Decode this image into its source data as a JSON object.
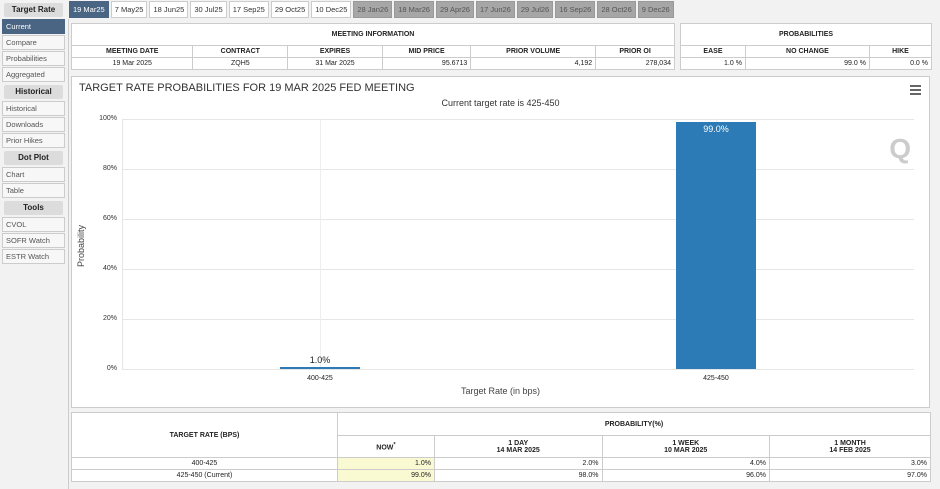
{
  "sidebar": {
    "sections": [
      {
        "title": "Target Rate",
        "items": [
          "Current",
          "Compare",
          "Probabilities",
          "Aggregated"
        ]
      },
      {
        "title": "Historical",
        "items": [
          "Historical",
          "Downloads",
          "Prior Hikes"
        ]
      },
      {
        "title": "Dot Plot",
        "items": [
          "Chart",
          "Table"
        ]
      },
      {
        "title": "Tools",
        "items": [
          "CVOL",
          "SOFR Watch",
          "ESTR Watch"
        ]
      }
    ]
  },
  "tabs": [
    "19 Mar25",
    "7 May25",
    "18 Jun25",
    "30 Jul25",
    "17 Sep25",
    "29 Oct25",
    "10 Dec25",
    "28 Jan26",
    "18 Mar26",
    "29 Apr26",
    "17 Jun26",
    "29 Jul26",
    "16 Sep26",
    "28 Oct26",
    "9 Dec26"
  ],
  "meeting": {
    "title": "MEETING INFORMATION",
    "headers": [
      "MEETING DATE",
      "CONTRACT",
      "EXPIRES",
      "MID PRICE",
      "PRIOR VOLUME",
      "PRIOR OI"
    ],
    "values": [
      "19 Mar 2025",
      "ZQH5",
      "31 Mar 2025",
      "95.6713",
      "4,192",
      "278,034"
    ]
  },
  "probs": {
    "title": "PROBABILITIES",
    "headers": [
      "EASE",
      "NO CHANGE",
      "HIKE"
    ],
    "values": [
      "1.0 %",
      "99.0 %",
      "0.0 %"
    ]
  },
  "chart_data": {
    "type": "bar",
    "title": "TARGET RATE PROBABILITIES FOR 19 MAR 2025 FED MEETING",
    "subtitle": "Current target rate is 425-450",
    "categories": [
      "400-425",
      "425-450"
    ],
    "values": [
      1.0,
      99.0
    ],
    "labels": [
      "1.0%",
      "99.0%"
    ],
    "xlabel": "Target Rate (in bps)",
    "ylabel": "Probability",
    "ylim": [
      0,
      100
    ],
    "yticks": [
      "0%",
      "20%",
      "40%",
      "60%",
      "80%",
      "100%"
    ],
    "color": "#2c7bb6"
  },
  "bottom": {
    "rate_header": "TARGET RATE (BPS)",
    "prob_header": "PROBABILITY(%)",
    "cols": [
      {
        "l1": "NOW",
        "l2": "*"
      },
      {
        "l1": "1 DAY",
        "l2": "14 MAR 2025"
      },
      {
        "l1": "1 WEEK",
        "l2": "10 MAR 2025"
      },
      {
        "l1": "1 MONTH",
        "l2": "14 FEB 2025"
      }
    ],
    "rows": [
      {
        "rate": "400-425",
        "v": [
          "1.0%",
          "2.0%",
          "4.0%",
          "3.0%"
        ]
      },
      {
        "rate": "425-450 (Current)",
        "v": [
          "99.0%",
          "98.0%",
          "96.0%",
          "97.0%"
        ]
      }
    ]
  }
}
